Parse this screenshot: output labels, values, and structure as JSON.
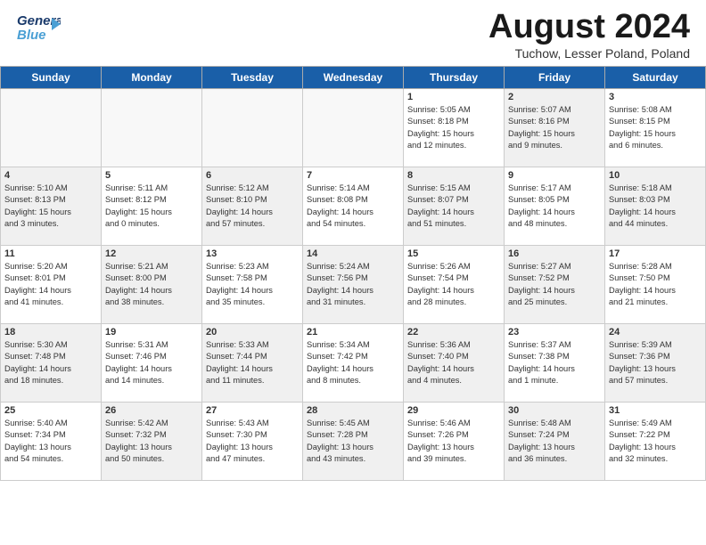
{
  "header": {
    "logo_line1": "General",
    "logo_line2": "Blue",
    "month_title": "August 2024",
    "location": "Tuchow, Lesser Poland, Poland"
  },
  "weekdays": [
    "Sunday",
    "Monday",
    "Tuesday",
    "Wednesday",
    "Thursday",
    "Friday",
    "Saturday"
  ],
  "weeks": [
    [
      {
        "day": "",
        "info": "",
        "shaded": true
      },
      {
        "day": "",
        "info": "",
        "shaded": true
      },
      {
        "day": "",
        "info": "",
        "shaded": true
      },
      {
        "day": "",
        "info": "",
        "shaded": true
      },
      {
        "day": "1",
        "info": "Sunrise: 5:05 AM\nSunset: 8:18 PM\nDaylight: 15 hours\nand 12 minutes.",
        "shaded": false
      },
      {
        "day": "2",
        "info": "Sunrise: 5:07 AM\nSunset: 8:16 PM\nDaylight: 15 hours\nand 9 minutes.",
        "shaded": true
      },
      {
        "day": "3",
        "info": "Sunrise: 5:08 AM\nSunset: 8:15 PM\nDaylight: 15 hours\nand 6 minutes.",
        "shaded": false
      }
    ],
    [
      {
        "day": "4",
        "info": "Sunrise: 5:10 AM\nSunset: 8:13 PM\nDaylight: 15 hours\nand 3 minutes.",
        "shaded": true
      },
      {
        "day": "5",
        "info": "Sunrise: 5:11 AM\nSunset: 8:12 PM\nDaylight: 15 hours\nand 0 minutes.",
        "shaded": false
      },
      {
        "day": "6",
        "info": "Sunrise: 5:12 AM\nSunset: 8:10 PM\nDaylight: 14 hours\nand 57 minutes.",
        "shaded": true
      },
      {
        "day": "7",
        "info": "Sunrise: 5:14 AM\nSunset: 8:08 PM\nDaylight: 14 hours\nand 54 minutes.",
        "shaded": false
      },
      {
        "day": "8",
        "info": "Sunrise: 5:15 AM\nSunset: 8:07 PM\nDaylight: 14 hours\nand 51 minutes.",
        "shaded": true
      },
      {
        "day": "9",
        "info": "Sunrise: 5:17 AM\nSunset: 8:05 PM\nDaylight: 14 hours\nand 48 minutes.",
        "shaded": false
      },
      {
        "day": "10",
        "info": "Sunrise: 5:18 AM\nSunset: 8:03 PM\nDaylight: 14 hours\nand 44 minutes.",
        "shaded": true
      }
    ],
    [
      {
        "day": "11",
        "info": "Sunrise: 5:20 AM\nSunset: 8:01 PM\nDaylight: 14 hours\nand 41 minutes.",
        "shaded": false
      },
      {
        "day": "12",
        "info": "Sunrise: 5:21 AM\nSunset: 8:00 PM\nDaylight: 14 hours\nand 38 minutes.",
        "shaded": true
      },
      {
        "day": "13",
        "info": "Sunrise: 5:23 AM\nSunset: 7:58 PM\nDaylight: 14 hours\nand 35 minutes.",
        "shaded": false
      },
      {
        "day": "14",
        "info": "Sunrise: 5:24 AM\nSunset: 7:56 PM\nDaylight: 14 hours\nand 31 minutes.",
        "shaded": true
      },
      {
        "day": "15",
        "info": "Sunrise: 5:26 AM\nSunset: 7:54 PM\nDaylight: 14 hours\nand 28 minutes.",
        "shaded": false
      },
      {
        "day": "16",
        "info": "Sunrise: 5:27 AM\nSunset: 7:52 PM\nDaylight: 14 hours\nand 25 minutes.",
        "shaded": true
      },
      {
        "day": "17",
        "info": "Sunrise: 5:28 AM\nSunset: 7:50 PM\nDaylight: 14 hours\nand 21 minutes.",
        "shaded": false
      }
    ],
    [
      {
        "day": "18",
        "info": "Sunrise: 5:30 AM\nSunset: 7:48 PM\nDaylight: 14 hours\nand 18 minutes.",
        "shaded": true
      },
      {
        "day": "19",
        "info": "Sunrise: 5:31 AM\nSunset: 7:46 PM\nDaylight: 14 hours\nand 14 minutes.",
        "shaded": false
      },
      {
        "day": "20",
        "info": "Sunrise: 5:33 AM\nSunset: 7:44 PM\nDaylight: 14 hours\nand 11 minutes.",
        "shaded": true
      },
      {
        "day": "21",
        "info": "Sunrise: 5:34 AM\nSunset: 7:42 PM\nDaylight: 14 hours\nand 8 minutes.",
        "shaded": false
      },
      {
        "day": "22",
        "info": "Sunrise: 5:36 AM\nSunset: 7:40 PM\nDaylight: 14 hours\nand 4 minutes.",
        "shaded": true
      },
      {
        "day": "23",
        "info": "Sunrise: 5:37 AM\nSunset: 7:38 PM\nDaylight: 14 hours\nand 1 minute.",
        "shaded": false
      },
      {
        "day": "24",
        "info": "Sunrise: 5:39 AM\nSunset: 7:36 PM\nDaylight: 13 hours\nand 57 minutes.",
        "shaded": true
      }
    ],
    [
      {
        "day": "25",
        "info": "Sunrise: 5:40 AM\nSunset: 7:34 PM\nDaylight: 13 hours\nand 54 minutes.",
        "shaded": false
      },
      {
        "day": "26",
        "info": "Sunrise: 5:42 AM\nSunset: 7:32 PM\nDaylight: 13 hours\nand 50 minutes.",
        "shaded": true
      },
      {
        "day": "27",
        "info": "Sunrise: 5:43 AM\nSunset: 7:30 PM\nDaylight: 13 hours\nand 47 minutes.",
        "shaded": false
      },
      {
        "day": "28",
        "info": "Sunrise: 5:45 AM\nSunset: 7:28 PM\nDaylight: 13 hours\nand 43 minutes.",
        "shaded": true
      },
      {
        "day": "29",
        "info": "Sunrise: 5:46 AM\nSunset: 7:26 PM\nDaylight: 13 hours\nand 39 minutes.",
        "shaded": false
      },
      {
        "day": "30",
        "info": "Sunrise: 5:48 AM\nSunset: 7:24 PM\nDaylight: 13 hours\nand 36 minutes.",
        "shaded": true
      },
      {
        "day": "31",
        "info": "Sunrise: 5:49 AM\nSunset: 7:22 PM\nDaylight: 13 hours\nand 32 minutes.",
        "shaded": false
      }
    ]
  ]
}
